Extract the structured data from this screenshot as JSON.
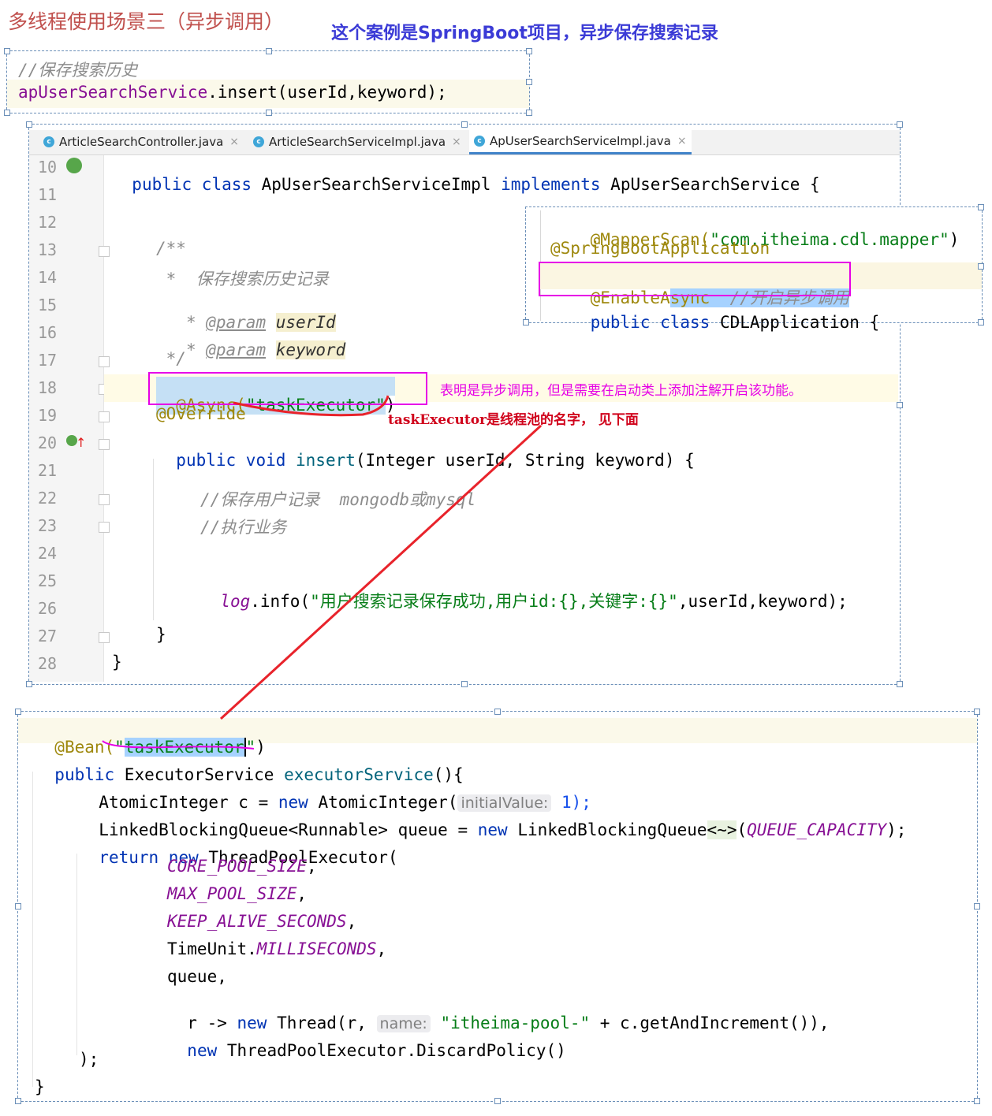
{
  "page": {
    "title": "多线程使用场景三（异步调用）",
    "subtitle": "这个案例是SpringBoot项目，异步保存搜索记录"
  },
  "snippet1": {
    "comment": "//保存搜索历史",
    "obj": "apUserSearchService",
    "call": ".insert(userId,keyword);"
  },
  "editor": {
    "tabs": [
      {
        "icon": "c",
        "label": "ArticleSearchController.java",
        "close": "×"
      },
      {
        "icon": "c",
        "label": "ArticleSearchServiceImpl.java",
        "close": "×"
      },
      {
        "icon": "c",
        "label": "ApUserSearchServiceImpl.java",
        "close": "×"
      }
    ],
    "line_numbers": [
      "10",
      "11",
      "12",
      "13",
      "14",
      "15",
      "16",
      "17",
      "18",
      "19",
      "20",
      "21",
      "22",
      "23",
      "24",
      "25",
      "26",
      "27",
      "28"
    ],
    "code": {
      "l10_kw": "public class",
      "l10_name": " ApUserSearchServiceImpl ",
      "l10_impl": "implements",
      "l10_iface": " ApUserSearchService {",
      "l13": "/**",
      "l14": " *  保存搜索历史记录",
      "l15_star": " * ",
      "l15_tag": "@param",
      "l15_name": "userId",
      "l16_star": " * ",
      "l16_tag": "@param",
      "l16_name": "keyword",
      "l17": " */",
      "l18_ann": "@Async(",
      "l18_str": "\"taskExecutor\"",
      "l18_close": ")",
      "l19": "@Override",
      "l20_kw": "public void",
      "l20_method": " insert",
      "l20_rest": "(Integer userId, String keyword) {",
      "l22": "//保存用户记录  mongodb或mysql",
      "l23": "//执行业务",
      "l25_log": "log",
      "l25_info": ".info(",
      "l25_str": "\"用户搜索记录保存成功,用户id:{},关键字:{}\"",
      "l25_rest": ",userId,keyword);",
      "l27": "}",
      "l28": "}"
    }
  },
  "app_popup": {
    "line1_ann": "@MapperScan(",
    "line1_str": "\"com.itheima.cdl.mapper\"",
    "line1_close": ")",
    "line2": "@SpringBootApplication",
    "line3_ann": "@EnableA",
    "line3_sel": "sync",
    "line3_cmt": "  //开启异步调用",
    "line4_kw": "public class",
    "line4_rest": " CDLApplication {"
  },
  "annotations": {
    "note1": "表明是异步调用，但是需要在启动类上添加注解开启该功能。",
    "note2": "taskExecutor是线程池的名字， 见下面"
  },
  "bean_snippet": {
    "l1_ann": "@Bean(",
    "l1_q1": "\"",
    "l1_sel": "taskExecutor",
    "l1_q2": "\"",
    "l1_close": ")",
    "l2_kw": "public",
    "l2_type": " ExecutorService ",
    "l2_method": "executorService",
    "l2_rest": "(){",
    "l3_a": "AtomicInteger c = ",
    "l3_new": "new",
    "l3_b": " AtomicInteger(",
    "l3_hint": "initialValue:",
    "l3_c": " 1);",
    "l4_a": "LinkedBlockingQueue<Runnable> queue = ",
    "l4_new": "new",
    "l4_b": " LinkedBlockingQueue",
    "l4_diamond": "<~>",
    "l4_c": "(",
    "l4_field": "QUEUE_CAPACITY",
    "l4_d": ");",
    "l5_kw": "return new",
    "l5_rest": " ThreadPoolExecutor(",
    "l6": "CORE_POOL_SIZE",
    "l7": "MAX_POOL_SIZE",
    "l8": "KEEP_ALIVE_SECONDS",
    "l9_a": "TimeUnit.",
    "l9_field": "MILLISECONDS",
    "l10": "queue,",
    "l11_a": "r -> ",
    "l11_new": "new",
    "l11_b": " Thread(r, ",
    "l11_hint": "name:",
    "l11_str": " \"itheima-pool-\"",
    "l11_c": " + c.getAndIncrement()),",
    "l12_new": "new",
    "l12_rest": " ThreadPoolExecutor.DiscardPolicy()",
    "l13": ");",
    "l14": "}",
    "comma": ","
  },
  "colors": {
    "title": "#c0504d",
    "subtitle": "#3b3bd6",
    "highlight_box": "#e600e6",
    "arrow": "#e8232b",
    "note1": "#e600e6",
    "note2": "#d0021b"
  }
}
